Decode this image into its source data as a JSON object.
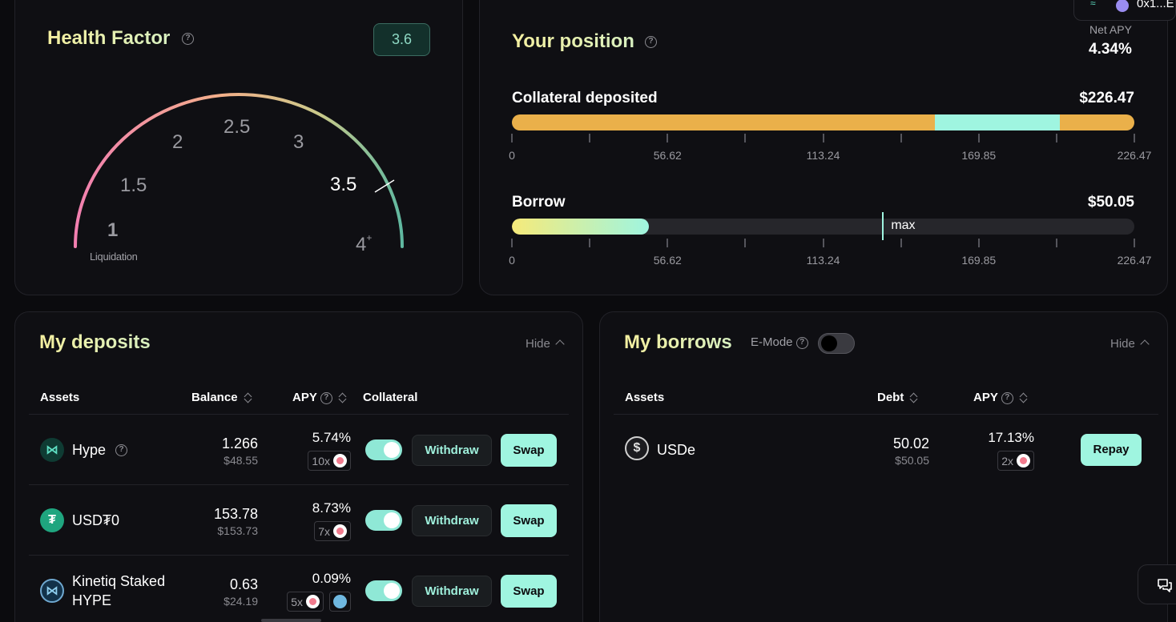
{
  "health_factor": {
    "title": "Health Factor",
    "value": "3.6",
    "gauge_labels": [
      "1",
      "1.5",
      "2",
      "2.5",
      "3",
      "3.5",
      "4"
    ],
    "gauge_max_suffix": "+",
    "liquidation_label": "Liquidation"
  },
  "position": {
    "title": "Your position",
    "net_apy_label": "Net APY",
    "net_apy_value": "4.34%",
    "collateral_label": "Collateral deposited",
    "collateral_value": "$226.47",
    "borrow_label": "Borrow",
    "borrow_value": "$50.05",
    "max_label": "max",
    "scale_labels": [
      "0",
      "56.62",
      "113.24",
      "169.85",
      "226.47"
    ],
    "collateral_bar": {
      "orange_1": 0.68,
      "teal": 0.2,
      "orange_2": 0.12
    },
    "borrow_fill": 0.22,
    "borrow_max_marker": 0.595
  },
  "deposits": {
    "title": "My deposits",
    "hide_label": "Hide",
    "columns": {
      "assets": "Assets",
      "balance": "Balance",
      "apy": "APY",
      "collateral": "Collateral"
    },
    "withdraw_label": "Withdraw",
    "swap_label": "Swap",
    "rows": [
      {
        "name": "Hype",
        "balance": "1.266",
        "balance_usd": "$48.55",
        "apy": "5.74%",
        "mult": "10x"
      },
      {
        "name": "USD₮0",
        "balance": "153.78",
        "balance_usd": "$153.73",
        "apy": "8.73%",
        "mult": "7x"
      },
      {
        "name_line1": "Kinetiq Staked",
        "name_line2": "HYPE",
        "balance": "0.63",
        "balance_usd": "$24.19",
        "apy": "0.09%",
        "mult": "5x"
      }
    ]
  },
  "borrows": {
    "title": "My borrows",
    "emode_label": "E-Mode",
    "hide_label": "Hide",
    "columns": {
      "assets": "Assets",
      "debt": "Debt",
      "apy": "APY"
    },
    "repay_label": "Repay",
    "rows": [
      {
        "name": "USDe",
        "debt": "50.02",
        "debt_usd": "$50.05",
        "apy": "17.13%",
        "mult": "2x"
      }
    ]
  },
  "wallet": {
    "address_fragment": "0x1...E"
  },
  "colors": {
    "accent_teal": "#9ff5e0",
    "orange": "#eab04a",
    "bg": "#0b0b0e"
  }
}
